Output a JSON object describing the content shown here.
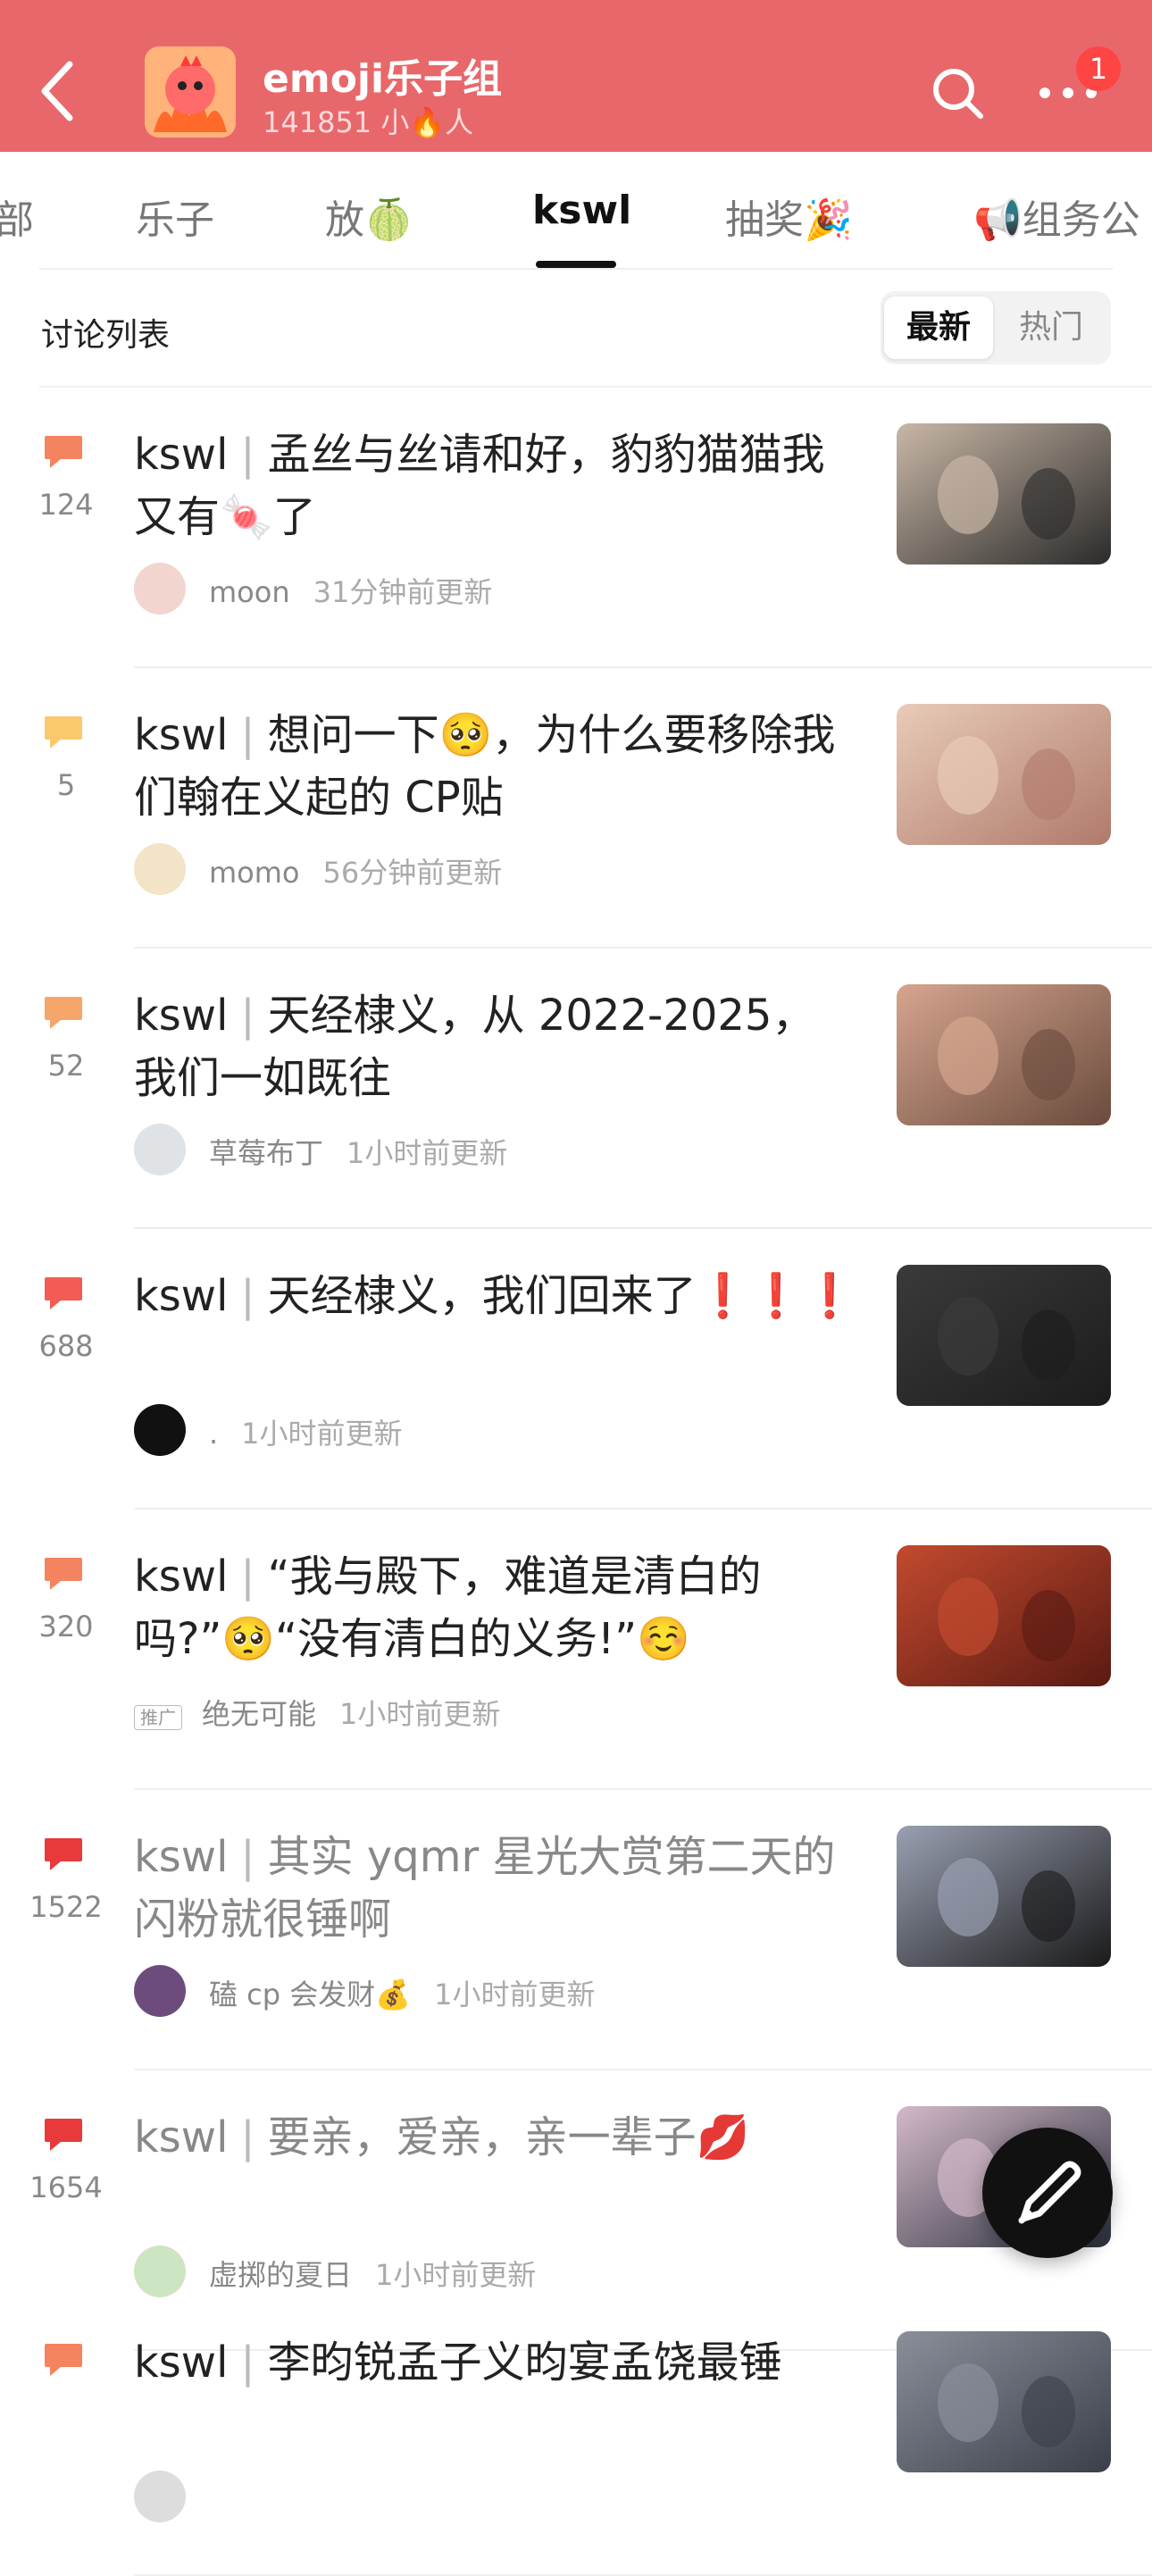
{
  "header": {
    "title": "emoji乐子组",
    "subtitle": "141851 小🔥人",
    "badge": "1",
    "bg_color": "#e8676a"
  },
  "tabs": [
    {
      "label": "部"
    },
    {
      "label": "乐子"
    },
    {
      "label": "放🍈"
    },
    {
      "label": "kswl",
      "active": true
    },
    {
      "label": "抽奖🎉"
    },
    {
      "label": "📢组务公"
    }
  ],
  "discussion": {
    "title": "讨论列表",
    "sort_latest": "最新",
    "sort_hot": "热门"
  },
  "posts": [
    {
      "count": "124",
      "tag": "kswl",
      "title": "孟丝与丝请和好，豹豹猫猫我又有🍬了",
      "author": "moon",
      "updated": "31分钟前更新",
      "icon_color": "#f4845f"
    },
    {
      "count": "5",
      "tag": "kswl",
      "title": "想问一下🥺，为什么要移除我们翰在义起的 CP贴",
      "author": "momo",
      "updated": "56分钟前更新",
      "icon_color": "#f9c96b"
    },
    {
      "count": "52",
      "tag": "kswl",
      "title": "天经棣义，从 2022-2025，我们一如既往",
      "author": "草莓布丁",
      "updated": "1小时前更新",
      "icon_color": "#f6a66a"
    },
    {
      "count": "688",
      "tag": "kswl",
      "title": "天经棣义，我们回来了❗️❗️❗️",
      "author": ".",
      "updated": "1小时前更新",
      "icon_color": "#f25c54"
    },
    {
      "count": "320",
      "tag": "kswl",
      "title": "“我与殿下，难道是清白的吗?”🥺“没有清白的义务!”☺️",
      "author": "绝无可能",
      "author_badge": "推广",
      "updated": "1小时前更新",
      "icon_color": "#f4845f"
    },
    {
      "count": "1522",
      "tag": "kswl",
      "title": "其实 yqmr 星光大赏第二天的闪粉就很锤啊",
      "author": "磕 cp 会发财💰",
      "updated": "1小时前更新",
      "icon_color": "#e83a3a",
      "dim": true
    },
    {
      "count": "1654",
      "tag": "kswl",
      "title": "要亲，爱亲，亲一辈子💋",
      "author": "虚掷的夏日",
      "updated": "1小时前更新",
      "icon_color": "#e83a3a",
      "dim": true
    },
    {
      "count": "",
      "tag": "kswl",
      "title": "李昀锐孟子义昀宴孟饶最锤",
      "author": "",
      "updated": "",
      "icon_color": "#f4845f"
    }
  ]
}
